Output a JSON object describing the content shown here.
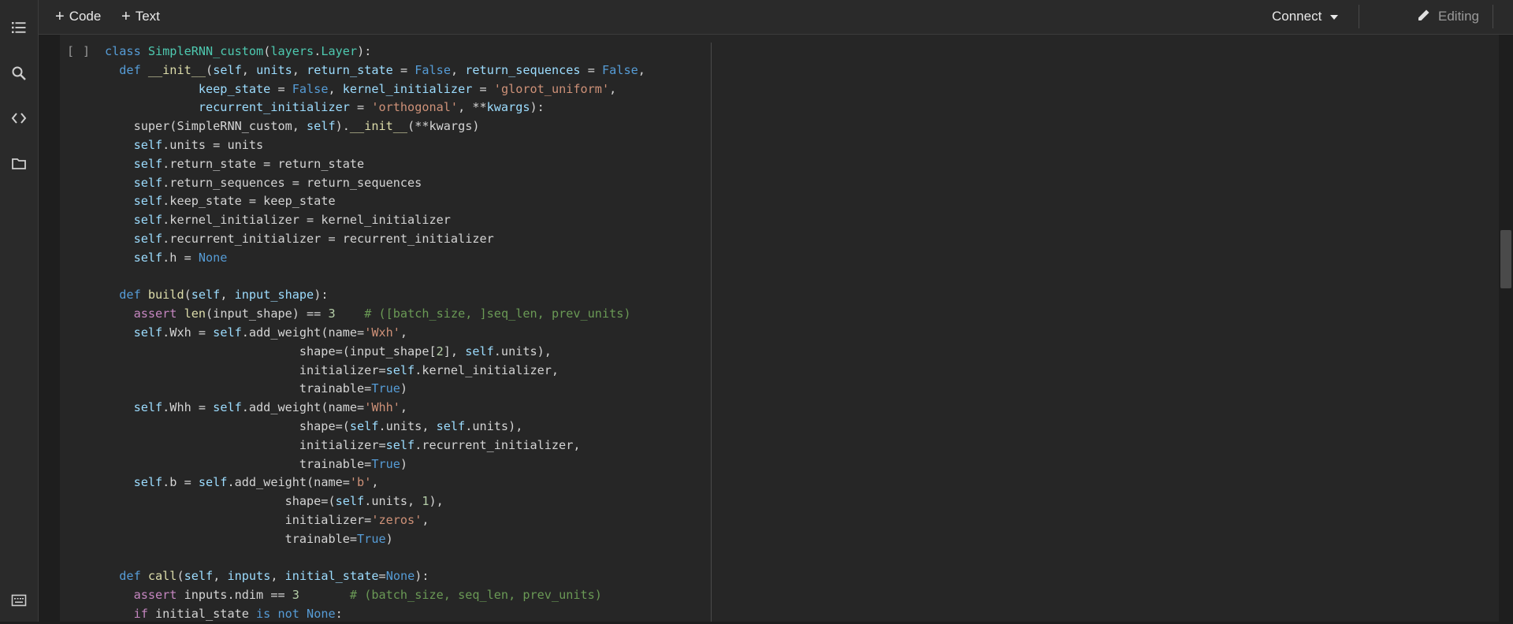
{
  "toolbar": {
    "code_label": "Code",
    "text_label": "Text",
    "connect_label": "Connect",
    "editing_label": "Editing"
  },
  "sidebar": {
    "items": [
      "table-of-contents-icon",
      "search-icon",
      "code-snippets-icon",
      "files-icon",
      "terminal-icon"
    ]
  },
  "cell": {
    "run_indicator": "[ ]"
  },
  "colors": {
    "keyword": "#569cd6",
    "control": "#c586c0",
    "function": "#dcdcaa",
    "class": "#4ec9b0",
    "string": "#ce9178",
    "number": "#b5cea8",
    "comment": "#6a9955",
    "param": "#9cdcfe",
    "default": "#d4d4d4"
  },
  "code": [
    [
      [
        "class ",
        "k"
      ],
      [
        "SimpleRNN_custom",
        "c"
      ],
      [
        "(",
        "d"
      ],
      [
        "layers",
        "c"
      ],
      [
        ".",
        "d"
      ],
      [
        "Layer",
        "c"
      ],
      [
        "):",
        "d"
      ]
    ],
    [
      [
        "  def ",
        "k"
      ],
      [
        "__init__",
        "f"
      ],
      [
        "(",
        "d"
      ],
      [
        "self",
        "p"
      ],
      [
        ", ",
        "d"
      ],
      [
        "units",
        "p"
      ],
      [
        ", ",
        "d"
      ],
      [
        "return_state",
        "p"
      ],
      [
        " = ",
        "d"
      ],
      [
        "False",
        "k"
      ],
      [
        ", ",
        "d"
      ],
      [
        "return_sequences",
        "p"
      ],
      [
        " = ",
        "d"
      ],
      [
        "False",
        "k"
      ],
      [
        ",",
        "d"
      ]
    ],
    [
      [
        "             keep_state",
        "p"
      ],
      [
        " = ",
        "d"
      ],
      [
        "False",
        "k"
      ],
      [
        ", ",
        "d"
      ],
      [
        "kernel_initializer",
        "p"
      ],
      [
        " = ",
        "d"
      ],
      [
        "'glorot_uniform'",
        "s"
      ],
      [
        ",",
        "d"
      ]
    ],
    [
      [
        "             recurrent_initializer",
        "p"
      ],
      [
        " = ",
        "d"
      ],
      [
        "'orthogonal'",
        "s"
      ],
      [
        ", **",
        "d"
      ],
      [
        "kwargs",
        "p"
      ],
      [
        "):",
        "d"
      ]
    ],
    [
      [
        "    super",
        "d"
      ],
      [
        "(SimpleRNN_custom, ",
        "d"
      ],
      [
        "self",
        "p"
      ],
      [
        ").",
        "d"
      ],
      [
        "__init__",
        "f"
      ],
      [
        "(**kwargs)",
        "d"
      ]
    ],
    [
      [
        "    self",
        "p"
      ],
      [
        ".units = units",
        "d"
      ]
    ],
    [
      [
        "    self",
        "p"
      ],
      [
        ".return_state = return_state",
        "d"
      ]
    ],
    [
      [
        "    self",
        "p"
      ],
      [
        ".return_sequences = return_sequences",
        "d"
      ]
    ],
    [
      [
        "    self",
        "p"
      ],
      [
        ".keep_state = keep_state",
        "d"
      ]
    ],
    [
      [
        "    self",
        "p"
      ],
      [
        ".kernel_initializer = kernel_initializer",
        "d"
      ]
    ],
    [
      [
        "    self",
        "p"
      ],
      [
        ".recurrent_initializer = recurrent_initializer",
        "d"
      ]
    ],
    [
      [
        "    self",
        "p"
      ],
      [
        ".h = ",
        "d"
      ],
      [
        "None",
        "k"
      ]
    ],
    [
      [
        "",
        "d"
      ]
    ],
    [
      [
        "  def ",
        "k"
      ],
      [
        "build",
        "f"
      ],
      [
        "(",
        "d"
      ],
      [
        "self",
        "p"
      ],
      [
        ", ",
        "d"
      ],
      [
        "input_shape",
        "p"
      ],
      [
        "):",
        "d"
      ]
    ],
    [
      [
        "    assert ",
        "x"
      ],
      [
        "len",
        "f"
      ],
      [
        "(input_shape) == ",
        "d"
      ],
      [
        "3",
        "n"
      ],
      [
        "    # ([batch_size, ]seq_len, prev_units)",
        "m"
      ]
    ],
    [
      [
        "    self",
        "p"
      ],
      [
        ".Wxh = ",
        "d"
      ],
      [
        "self",
        "p"
      ],
      [
        ".add_weight(name=",
        "d"
      ],
      [
        "'Wxh'",
        "s"
      ],
      [
        ",",
        "d"
      ]
    ],
    [
      [
        "                           shape=(input_shape[",
        "d"
      ],
      [
        "2",
        "n"
      ],
      [
        "], ",
        "d"
      ],
      [
        "self",
        "p"
      ],
      [
        ".units),",
        "d"
      ]
    ],
    [
      [
        "                           initializer=",
        "d"
      ],
      [
        "self",
        "p"
      ],
      [
        ".kernel_initializer,",
        "d"
      ]
    ],
    [
      [
        "                           trainable=",
        "d"
      ],
      [
        "True",
        "k"
      ],
      [
        ")",
        "d"
      ]
    ],
    [
      [
        "    self",
        "p"
      ],
      [
        ".Whh = ",
        "d"
      ],
      [
        "self",
        "p"
      ],
      [
        ".add_weight(name=",
        "d"
      ],
      [
        "'Whh'",
        "s"
      ],
      [
        ",",
        "d"
      ]
    ],
    [
      [
        "                           shape=(",
        "d"
      ],
      [
        "self",
        "p"
      ],
      [
        ".units, ",
        "d"
      ],
      [
        "self",
        "p"
      ],
      [
        ".units),",
        "d"
      ]
    ],
    [
      [
        "                           initializer=",
        "d"
      ],
      [
        "self",
        "p"
      ],
      [
        ".recurrent_initializer,",
        "d"
      ]
    ],
    [
      [
        "                           trainable=",
        "d"
      ],
      [
        "True",
        "k"
      ],
      [
        ")",
        "d"
      ]
    ],
    [
      [
        "    self",
        "p"
      ],
      [
        ".b = ",
        "d"
      ],
      [
        "self",
        "p"
      ],
      [
        ".add_weight(name=",
        "d"
      ],
      [
        "'b'",
        "s"
      ],
      [
        ",",
        "d"
      ]
    ],
    [
      [
        "                         shape=(",
        "d"
      ],
      [
        "self",
        "p"
      ],
      [
        ".units, ",
        "d"
      ],
      [
        "1",
        "n"
      ],
      [
        "),",
        "d"
      ]
    ],
    [
      [
        "                         initializer=",
        "d"
      ],
      [
        "'zeros'",
        "s"
      ],
      [
        ",",
        "d"
      ]
    ],
    [
      [
        "                         trainable=",
        "d"
      ],
      [
        "True",
        "k"
      ],
      [
        ")",
        "d"
      ]
    ],
    [
      [
        "",
        "d"
      ]
    ],
    [
      [
        "  def ",
        "k"
      ],
      [
        "call",
        "f"
      ],
      [
        "(",
        "d"
      ],
      [
        "self",
        "p"
      ],
      [
        ", ",
        "d"
      ],
      [
        "inputs",
        "p"
      ],
      [
        ", ",
        "d"
      ],
      [
        "initial_state",
        "p"
      ],
      [
        "=",
        "d"
      ],
      [
        "None",
        "k"
      ],
      [
        "):",
        "d"
      ]
    ],
    [
      [
        "    assert ",
        "x"
      ],
      [
        "inputs.ndim == ",
        "d"
      ],
      [
        "3",
        "n"
      ],
      [
        "       # (batch_size, seq_len, prev_units)",
        "m"
      ]
    ],
    [
      [
        "    if ",
        "x"
      ],
      [
        "initial_state ",
        "d"
      ],
      [
        "is not ",
        "k"
      ],
      [
        "None",
        "k"
      ],
      [
        ":",
        "d"
      ]
    ]
  ]
}
